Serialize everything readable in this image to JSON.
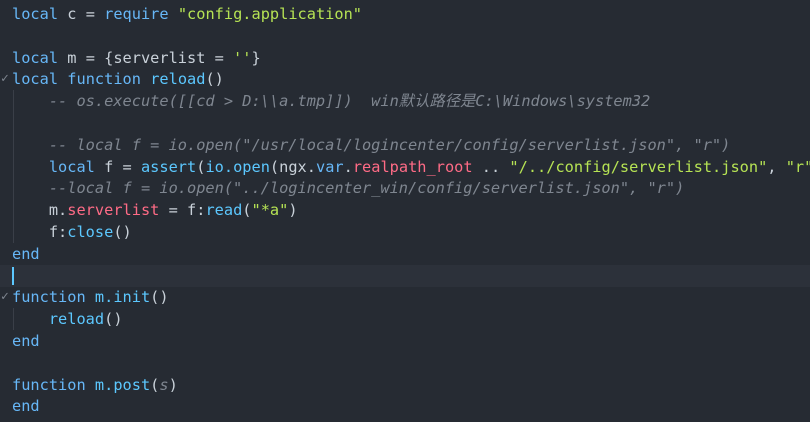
{
  "editor": {
    "language": "lua",
    "theme": {
      "background": "#262b33",
      "current_line": "#2c313a",
      "cursor": "#5cc8ff"
    },
    "lines": [
      [
        {
          "t": "local",
          "c": "kw"
        },
        {
          "t": " c = ",
          "c": "op"
        },
        {
          "t": "require",
          "c": "kw"
        },
        {
          "t": " ",
          "c": "op"
        },
        {
          "t": "\"config.application\"",
          "c": "str"
        }
      ],
      [],
      [
        {
          "t": "local",
          "c": "kw"
        },
        {
          "t": " m = {serverlist = ",
          "c": "op"
        },
        {
          "t": "''",
          "c": "str"
        },
        {
          "t": "}",
          "c": "op"
        }
      ],
      [
        {
          "t": "local",
          "c": "kw"
        },
        {
          "t": " ",
          "c": "op"
        },
        {
          "t": "function",
          "c": "kw"
        },
        {
          "t": " ",
          "c": "op"
        },
        {
          "t": "reload",
          "c": "fn"
        },
        {
          "t": "()",
          "c": "op"
        }
      ],
      [
        {
          "t": "    ",
          "c": "op"
        },
        {
          "t": "-- os.execute([[cd > D:\\\\a.tmp]])  win默认路径是C:\\Windows\\system32",
          "c": "cm"
        }
      ],
      [],
      [
        {
          "t": "    ",
          "c": "op"
        },
        {
          "t": "-- local f = io.open(\"/usr/local/logincenter/config/serverlist.json\", \"r\")",
          "c": "cm"
        }
      ],
      [
        {
          "t": "    ",
          "c": "op"
        },
        {
          "t": "local",
          "c": "kw"
        },
        {
          "t": " f = ",
          "c": "op"
        },
        {
          "t": "assert",
          "c": "fn"
        },
        {
          "t": "(",
          "c": "op"
        },
        {
          "t": "io.open",
          "c": "fn"
        },
        {
          "t": "(ngx.",
          "c": "op"
        },
        {
          "t": "var",
          "c": "kw"
        },
        {
          "t": ".",
          "c": "op"
        },
        {
          "t": "realpath_root",
          "c": "field"
        },
        {
          "t": " .. ",
          "c": "op"
        },
        {
          "t": "\"/../config/serverlist.json\"",
          "c": "str"
        },
        {
          "t": ", ",
          "c": "op"
        },
        {
          "t": "\"r\"",
          "c": "str"
        },
        {
          "t": "))",
          "c": "op"
        }
      ],
      [
        {
          "t": "    ",
          "c": "op"
        },
        {
          "t": "--local f = io.open(\"../logincenter_win/config/serverlist.json\", \"r\")",
          "c": "cm"
        }
      ],
      [
        {
          "t": "    m.",
          "c": "op"
        },
        {
          "t": "serverlist",
          "c": "field"
        },
        {
          "t": " = f:",
          "c": "op"
        },
        {
          "t": "read",
          "c": "fn"
        },
        {
          "t": "(",
          "c": "op"
        },
        {
          "t": "\"*a\"",
          "c": "str"
        },
        {
          "t": ")",
          "c": "op"
        }
      ],
      [
        {
          "t": "    f:",
          "c": "op"
        },
        {
          "t": "close",
          "c": "fn"
        },
        {
          "t": "()",
          "c": "op"
        }
      ],
      [
        {
          "t": "end",
          "c": "kw"
        }
      ],
      [],
      [
        {
          "t": "function",
          "c": "kw"
        },
        {
          "t": " ",
          "c": "op"
        },
        {
          "t": "m.init",
          "c": "fn"
        },
        {
          "t": "()",
          "c": "op"
        }
      ],
      [
        {
          "t": "    ",
          "c": "op"
        },
        {
          "t": "reload",
          "c": "fn"
        },
        {
          "t": "()",
          "c": "op"
        }
      ],
      [
        {
          "t": "end",
          "c": "kw"
        }
      ],
      [],
      [
        {
          "t": "function",
          "c": "kw"
        },
        {
          "t": " ",
          "c": "op"
        },
        {
          "t": "m.post",
          "c": "fn"
        },
        {
          "t": "(",
          "c": "op"
        },
        {
          "t": "s",
          "c": "cm"
        },
        {
          "t": ")",
          "c": "op"
        }
      ],
      [
        {
          "t": "end",
          "c": "kw"
        }
      ]
    ],
    "fold_markers": [
      {
        "line": 3,
        "icon": "chevron-down-icon",
        "glyph": "✓"
      },
      {
        "line": 13,
        "icon": "chevron-down-icon",
        "glyph": "✓"
      }
    ],
    "current_line": 12
  }
}
